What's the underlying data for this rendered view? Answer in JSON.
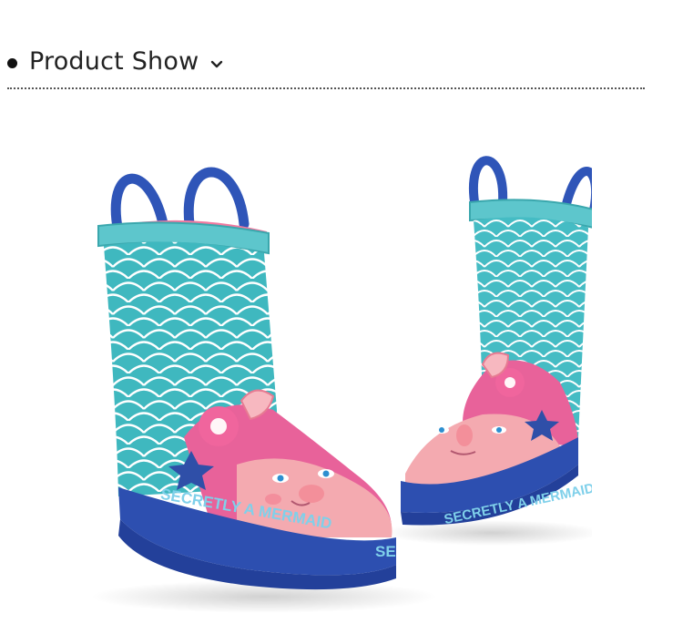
{
  "section": {
    "title": "Product Show",
    "expand_icon": "chevron-down-icon"
  },
  "product_image": {
    "left_boot_print": "SECRETLY A MERMAID",
    "left_boot_heel_print": "SE",
    "right_boot_print": "SECRETLY A MERMAID",
    "colors": {
      "shaft": "#3fb8bf",
      "sole": "#2d4fb0",
      "pink_panel": "#e8629a",
      "handles": "#2f55b8",
      "lining": "#f07aa0"
    }
  }
}
